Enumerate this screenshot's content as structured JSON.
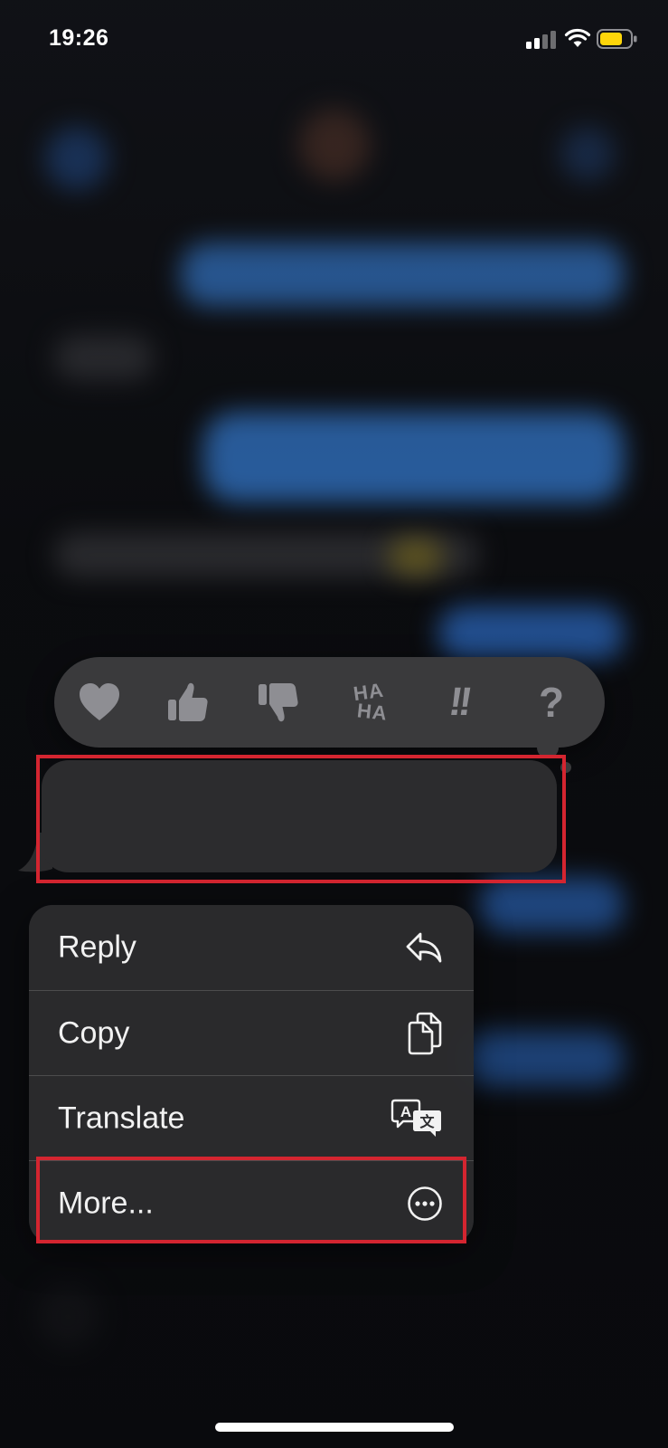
{
  "status_bar": {
    "time": "19:26",
    "battery_color": "#ffd60a"
  },
  "reactions": [
    {
      "name": "heart-icon"
    },
    {
      "name": "thumbs-up-icon"
    },
    {
      "name": "thumbs-down-icon"
    },
    {
      "name": "haha-icon",
      "text_top": "HA",
      "text_bottom": "HA"
    },
    {
      "name": "exclamation-icon",
      "text": "!!"
    },
    {
      "name": "question-icon",
      "text": "?"
    }
  ],
  "menu": {
    "items": [
      {
        "label": "Reply",
        "icon": "reply-arrow-icon"
      },
      {
        "label": "Copy",
        "icon": "copy-icon"
      },
      {
        "label": "Translate",
        "icon": "translate-icon"
      },
      {
        "label": "More...",
        "icon": "more-ellipsis-icon"
      }
    ]
  },
  "colors": {
    "accent_blue": "#2f7ff5",
    "highlight_red": "#d42530",
    "bubble_gray": "#2c2c2e",
    "reaction_gray": "#8e8e93"
  }
}
